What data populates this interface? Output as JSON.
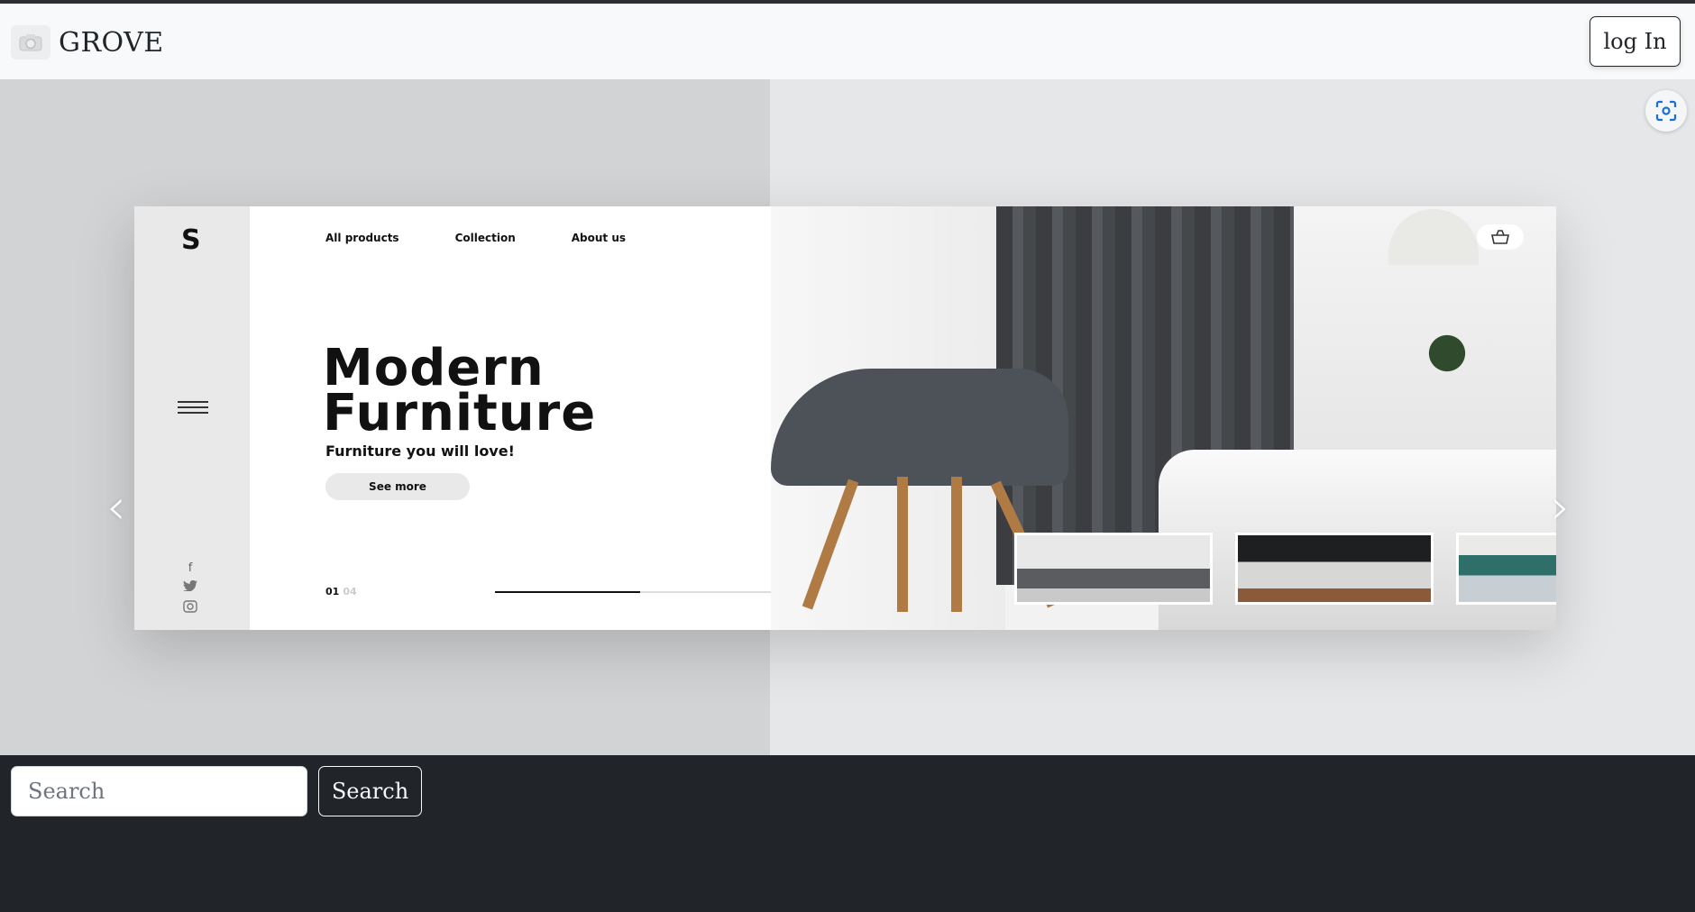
{
  "navbar": {
    "brand": "GROVE",
    "brand_icon": "camera-icon",
    "login_label": "log In"
  },
  "hero": {
    "scan_icon": "screen-capture-icon",
    "prev_icon": "chevron-left-icon",
    "next_icon": "chevron-right-icon",
    "card": {
      "side_logo": "S",
      "menu_icon": "hamburger-icon",
      "social_icons": [
        "facebook-icon",
        "twitter-icon",
        "instagram-icon"
      ],
      "nav": [
        "All products",
        "Collection",
        "About us"
      ],
      "title_line1": "Modern",
      "title_line2": "Furniture",
      "subtitle": "Furniture you will love!",
      "cta_label": "See more",
      "counter_current": "01",
      "counter_total": "04",
      "progress": 0.46,
      "cart_icon": "shopping-bag-icon"
    }
  },
  "search": {
    "placeholder": "Search",
    "button_label": "Search"
  },
  "colors": {
    "navbar_bg": "#f8f9fa",
    "footer_bg": "#212529",
    "hero_left_bg": "#d2d3d5",
    "hero_right_bg": "#e6e7e9"
  }
}
